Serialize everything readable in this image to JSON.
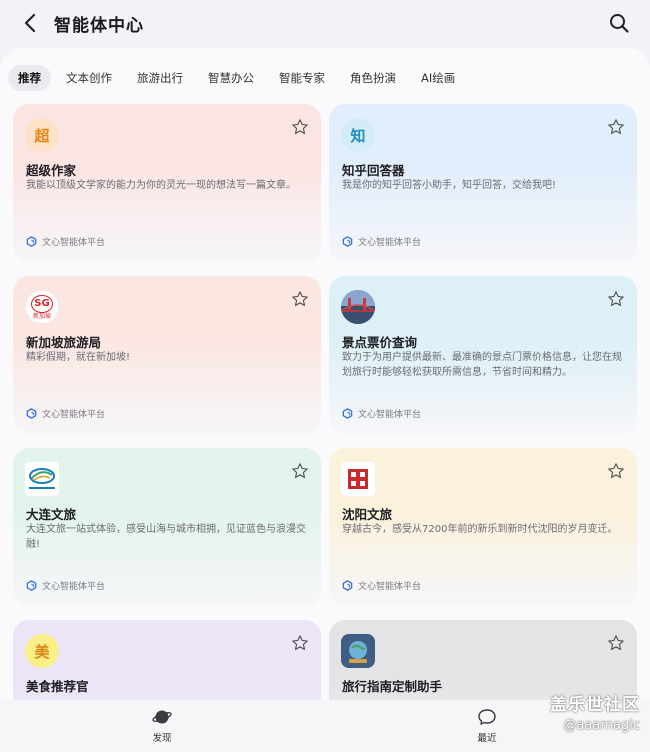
{
  "header": {
    "title": "智能体中心"
  },
  "tabs": [
    "推荐",
    "文本创作",
    "旅游出行",
    "智慧办公",
    "智能专家",
    "角色扮演",
    "AI绘画"
  ],
  "cards": [
    {
      "avatar_text": "超",
      "name": "超级作家",
      "desc": "我能以顶级文学家的能力为你的灵光一现的想法写一篇文章。",
      "platform": "文心智能体平台",
      "bg": "#fbe5e3",
      "avatar_bg": "#fde2c7",
      "avatar_color": "#e8861a"
    },
    {
      "avatar_text": "知",
      "name": "知乎回答器",
      "desc": "我是你的知乎回答小助手，知乎回答，交给我吧!",
      "platform": "文心智能体平台",
      "bg": "#e1eefb",
      "avatar_bg": "#d4ecf6",
      "avatar_color": "#1f8fc0"
    },
    {
      "avatar_text": "SG",
      "avatar_sub": "新加坡",
      "name": "新加坡旅游局",
      "desc": "精彩假期，就在新加坡!",
      "platform": "文心智能体平台",
      "bg": "#fbe6e2",
      "avatar_bg": "#ffffff",
      "avatar_color": "#d8262b"
    },
    {
      "avatar_text": "",
      "name": "景点票价查询",
      "desc": "致力于为用户提供最新、最准确的景点门票价格信息，让您在规划旅行时能够轻松获取所需信息，节省时间和精力。",
      "platform": "文心智能体平台",
      "bg": "#ddf0f8",
      "avatar_bg": "#7d93b8",
      "avatar_color": "#ffffff"
    },
    {
      "avatar_text": "",
      "name": "大连文旅",
      "desc": "大连文旅一站式体验，感受山海与城市相拥，见证蓝色与浪漫交融!",
      "platform": "文心智能体平台",
      "bg": "#e2f3ec",
      "avatar_bg": "#ffffff",
      "avatar_color": "#1a7fb8"
    },
    {
      "avatar_text": "",
      "name": "沈阳文旅",
      "desc": "穿越古今，感受从7200年前的新乐到新时代沈阳的岁月变迁。",
      "platform": "文心智能体平台",
      "bg": "#fbf2dc",
      "avatar_bg": "#ffffff",
      "avatar_color": "#c82a2a"
    },
    {
      "avatar_text": "美",
      "name": "美食推荐官",
      "desc": "",
      "platform": "",
      "bg": "#ece4f7",
      "avatar_bg": "#f8ef87",
      "avatar_color": "#d98614"
    },
    {
      "avatar_text": "",
      "name": "旅行指南定制助手",
      "desc": "",
      "platform": "",
      "bg": "#e4e4e6",
      "avatar_bg": "#4e6d8f",
      "avatar_color": "#ffffff"
    }
  ],
  "bottom_nav": {
    "discover": "发现",
    "recent": "最近"
  },
  "watermark": {
    "line1": "盖乐世社区",
    "line2": "@aaamagic"
  }
}
